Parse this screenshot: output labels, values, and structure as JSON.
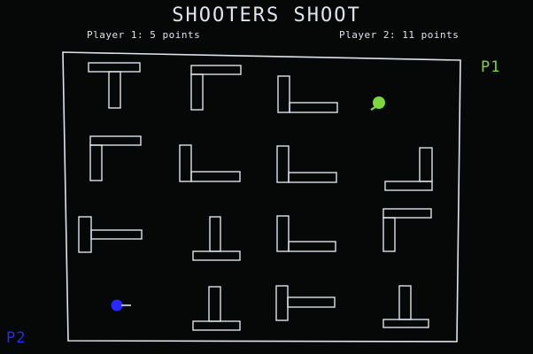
{
  "game": {
    "title": "SHOOTERS SHOOT"
  },
  "scores": {
    "player1": "Player 1: 5 points",
    "player2": "Player 2: 11 points"
  },
  "players": {
    "p1": {
      "label": "P1",
      "color": "#7dd63f"
    },
    "p2": {
      "label": "P2",
      "color": "#2828ff"
    }
  },
  "colors": {
    "background": "#060807",
    "walls": "#dde3ee",
    "text": "#dfe4ee"
  }
}
